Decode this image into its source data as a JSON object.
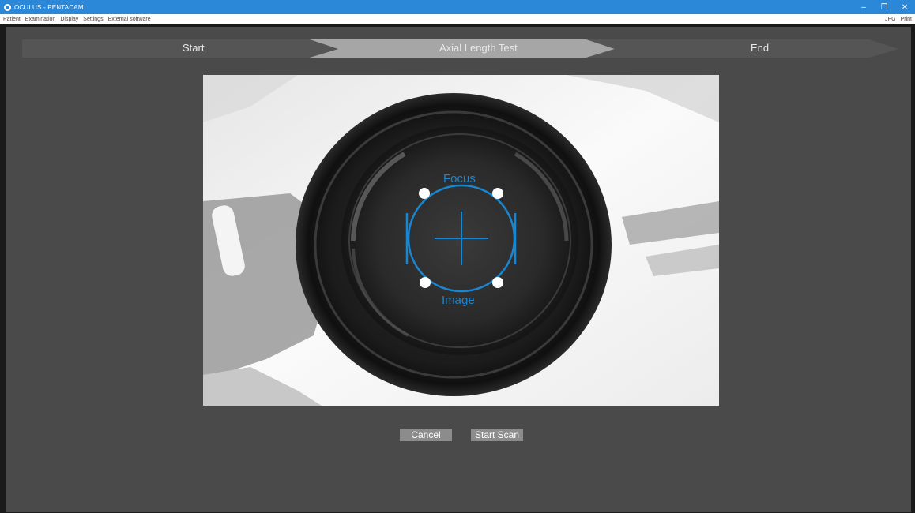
{
  "window": {
    "title": "OCULUS - PENTACAM",
    "icon": "oculus-app-icon",
    "controls": {
      "minimize": "–",
      "restore": "❐",
      "close": "✕"
    }
  },
  "menu": {
    "items": [
      "Patient",
      "Examination",
      "Display",
      "Settings",
      "External software"
    ],
    "right_items": [
      "JPG",
      "Print"
    ]
  },
  "steps": [
    {
      "label": "Start",
      "state": "done"
    },
    {
      "label": "Axial Length Test",
      "state": "active"
    },
    {
      "label": "End",
      "state": "pending"
    }
  ],
  "camera": {
    "focus_label": "Focus",
    "image_label": "Image",
    "overlay_color": "#1a86d0"
  },
  "buttons": {
    "cancel": "Cancel",
    "start_scan": "Start Scan"
  },
  "colors": {
    "titlebar": "#2b88d8",
    "background": "#4a4a4a",
    "step_done": "#555555",
    "step_active": "#a6a6a6",
    "button": "#8c8c8c"
  }
}
